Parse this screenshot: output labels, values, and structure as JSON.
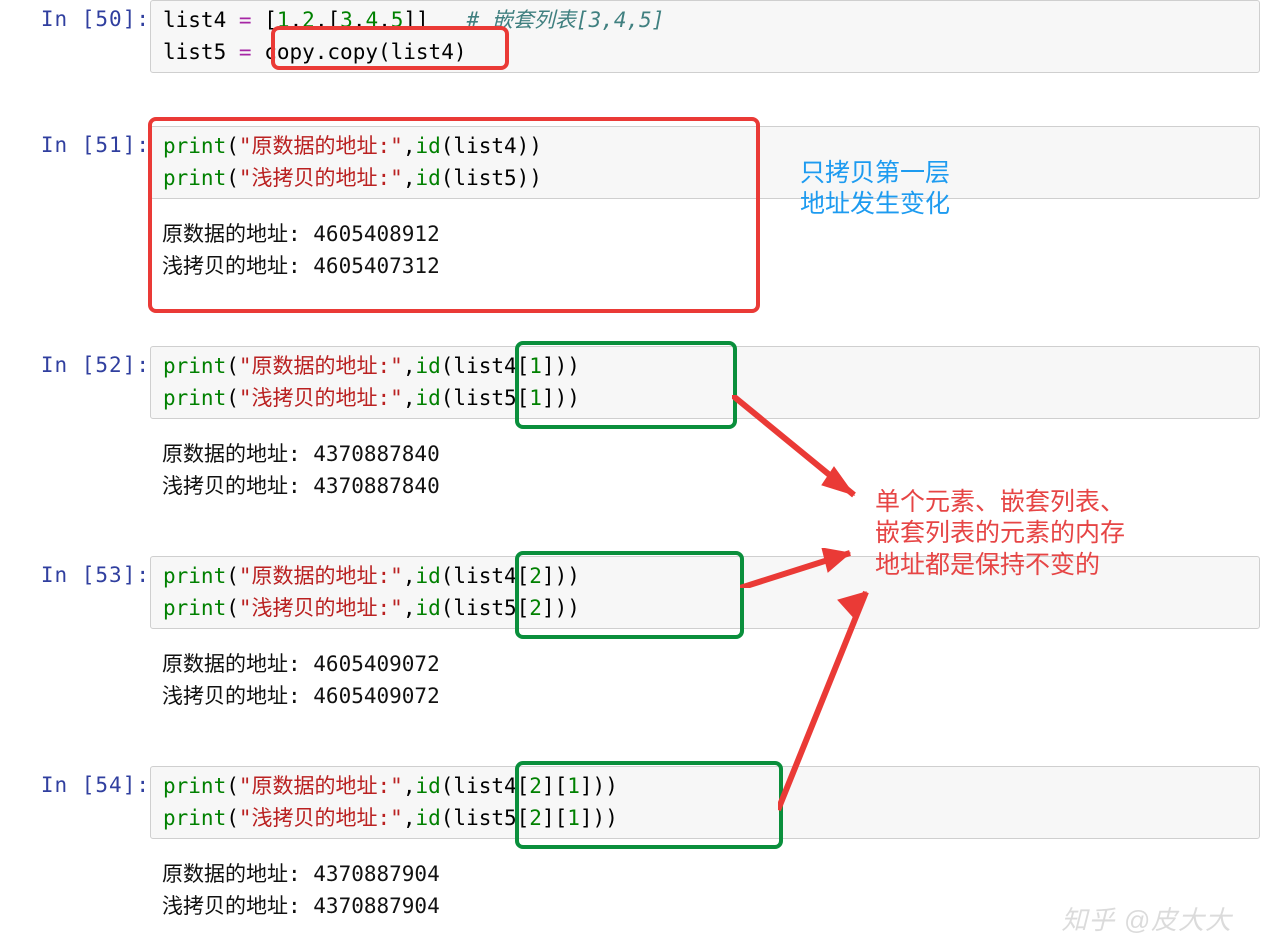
{
  "watermark": "知乎 @皮大大",
  "cells": {
    "c50": {
      "prompt": "In [50]:",
      "code": {
        "line1": {
          "list4": "list4",
          "eq": "=",
          "br1": "[",
          "n1": "1",
          "c1": ",",
          "n2": "2",
          "c2": ",",
          "br2": "[",
          "n3": "3",
          "c3": ",",
          "n4": "4",
          "c4": ",",
          "n5": "5",
          "br3": "]]",
          "sp": "   ",
          "cmt": "# 嵌套列表[3,4,5]"
        },
        "line2": {
          "list5": "list5",
          "eq": "=",
          "copy": "copy.copy(list4)"
        }
      }
    },
    "c51": {
      "prompt": "In [51]:",
      "code": {
        "p": "print",
        "lp": "(",
        "s1": "\"原数据的地址:\"",
        "cm": ",",
        "id": "id",
        "lp2": "(",
        "a1": "list4",
        "rp": "))",
        "s2": "\"浅拷贝的地址:\"",
        "a2": "list5"
      },
      "output": "原数据的地址: 4605408912\n浅拷贝的地址: 4605407312"
    },
    "c52": {
      "prompt": "In [52]:",
      "code": {
        "p": "print",
        "s1": "\"原数据的地址:\"",
        "s2": "\"浅拷贝的地址:\"",
        "id": "id",
        "arg1": "list4",
        "arg2": "list5",
        "idx": "1"
      },
      "output": "原数据的地址: 4370887840\n浅拷贝的地址: 4370887840"
    },
    "c53": {
      "prompt": "In [53]:",
      "code": {
        "p": "print",
        "s1": "\"原数据的地址:\"",
        "s2": "\"浅拷贝的地址:\"",
        "id": "id",
        "arg1": "list4",
        "arg2": "list5",
        "idx": "2"
      },
      "output": "原数据的地址: 4605409072\n浅拷贝的地址: 4605409072"
    },
    "c54": {
      "prompt": "In [54]:",
      "code": {
        "p": "print",
        "s1": "\"原数据的地址:\"",
        "s2": "\"浅拷贝的地址:\"",
        "id": "id",
        "arg1": "list4",
        "arg2": "list5",
        "idx1": "2",
        "idx2": "1"
      },
      "output": "原数据的地址: 4370887904\n浅拷贝的地址: 4370887904"
    }
  },
  "annotations": {
    "blue1": "只拷贝第一层\n地址发生变化",
    "red1": "单个元素、嵌套列表、\n嵌套列表的元素的内存\n地址都是保持不变的"
  }
}
